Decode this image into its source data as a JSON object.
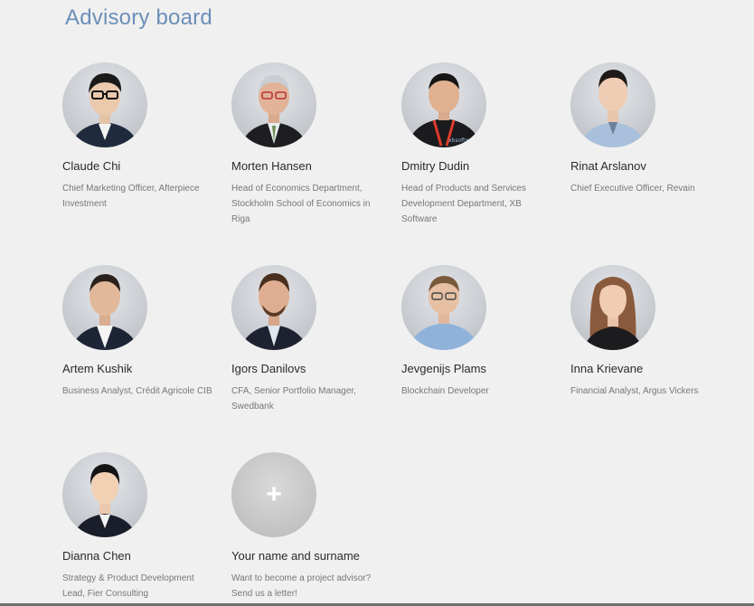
{
  "section": {
    "title": "Advisory board"
  },
  "colors": {
    "title": "#6b8fb8",
    "name": "#2a2a2a",
    "role": "#777777"
  },
  "advisors": [
    {
      "name": "Claude Chi",
      "role": "Chief Marketing Officer, Afterpiece Investment",
      "icon": "portrait-photo"
    },
    {
      "name": "Morten Hansen",
      "role": "Head of Economics Department, Stockholm School of Economics in Riga",
      "icon": "portrait-photo"
    },
    {
      "name": "Dmitry Dudin",
      "role": "Head of Products and Services Development Department, XB Software",
      "icon": "portrait-photo"
    },
    {
      "name": "Rinat Arslanov",
      "role": "Chief Executive Officer, Revain",
      "icon": "portrait-photo"
    },
    {
      "name": "Artem Kushik",
      "role": "Business Analyst, Crédit Agricole CIB",
      "icon": "portrait-photo"
    },
    {
      "name": "Igors Danilovs",
      "role": "CFA, Senior Portfolio Manager, Swedbank",
      "icon": "portrait-photo"
    },
    {
      "name": "Jevgenijs Plams",
      "role": "Blockchain Developer",
      "icon": "portrait-photo"
    },
    {
      "name": "Inna Krievane",
      "role": "Financial Analyst, Argus Vickers",
      "icon": "portrait-photo"
    },
    {
      "name": "Dianna Chen",
      "role": "Strategy & Product Development Lead, Fier Consulting",
      "icon": "portrait-photo"
    }
  ],
  "join": {
    "plus": "+",
    "name": "Your name and surname",
    "line1": "Want to become a project advisor?",
    "line2": "Send us a letter!"
  }
}
